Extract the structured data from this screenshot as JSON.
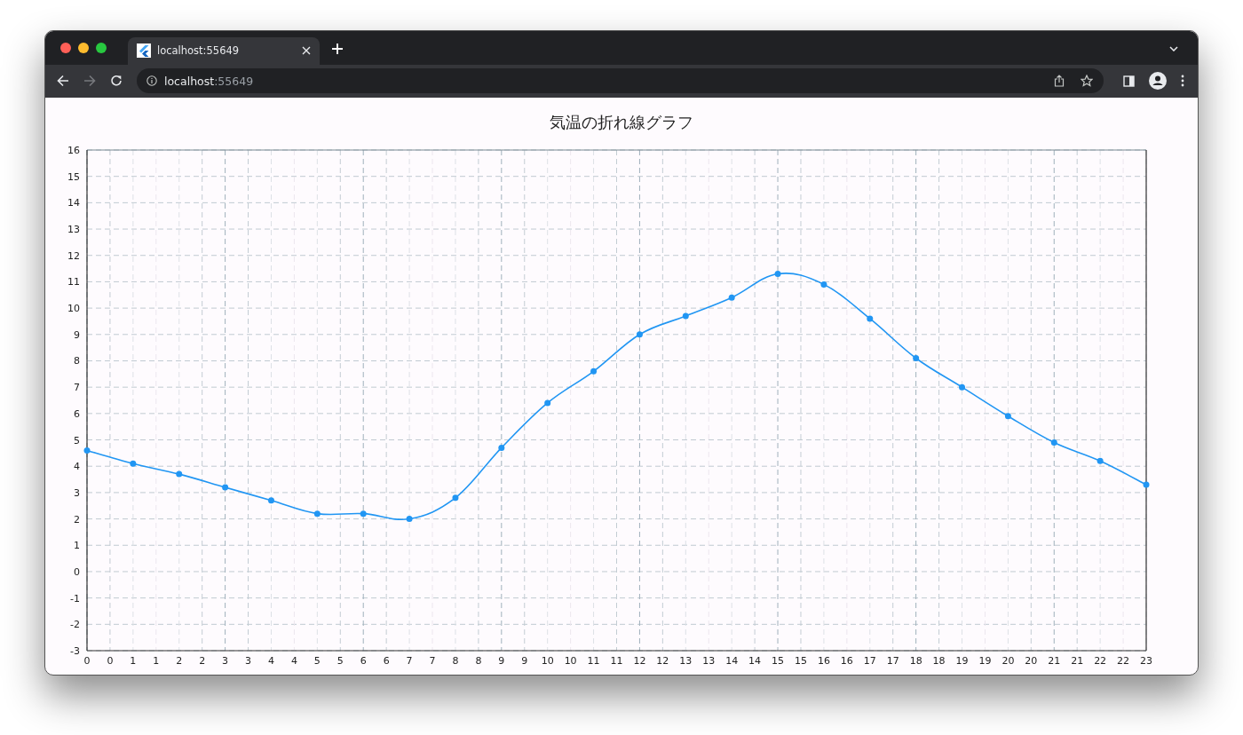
{
  "window": {
    "tab": {
      "title": "localhost:55649",
      "selected": true
    },
    "address": {
      "host": "localhost",
      "port": ":55649"
    },
    "nav": {
      "back_disabled": false,
      "forward_disabled": true
    }
  },
  "page": {
    "title": "気温の折れ線グラフ",
    "chart_data": {
      "type": "line",
      "x": [
        0,
        1,
        2,
        3,
        4,
        5,
        6,
        7,
        8,
        9,
        10,
        11,
        12,
        13,
        14,
        15,
        16,
        17,
        18,
        19,
        20,
        21,
        22,
        23
      ],
      "grid": true,
      "series": [
        {
          "color": "#2196f3",
          "marker": true,
          "values": [
            4.6,
            4.1,
            3.7,
            3.2,
            2.7,
            2.2,
            2.2,
            2.0,
            2.8,
            4.7,
            6.4,
            7.6,
            9.0,
            9.7,
            10.4,
            11.3,
            10.9,
            9.6,
            8.1,
            7.0,
            5.9,
            4.9,
            4.2,
            3.3
          ]
        }
      ],
      "xlim": [
        0,
        23
      ],
      "ylim": [
        -3,
        16
      ],
      "xticks": [
        {
          "value": 0,
          "label": "0"
        },
        {
          "value": 0.5,
          "label": "0"
        },
        {
          "value": 1,
          "label": "1"
        },
        {
          "value": 1.5,
          "label": "1"
        },
        {
          "value": 2,
          "label": "2"
        },
        {
          "value": 2.5,
          "label": "2"
        },
        {
          "value": 3,
          "label": "3"
        },
        {
          "value": 3.5,
          "label": "3"
        },
        {
          "value": 4,
          "label": "4"
        },
        {
          "value": 4.5,
          "label": "4"
        },
        {
          "value": 5,
          "label": "5"
        },
        {
          "value": 5.5,
          "label": "5"
        },
        {
          "value": 6,
          "label": "6"
        },
        {
          "value": 6.5,
          "label": "6"
        },
        {
          "value": 7,
          "label": "7"
        },
        {
          "value": 7.5,
          "label": "7"
        },
        {
          "value": 8,
          "label": "8"
        },
        {
          "value": 8.5,
          "label": "8"
        },
        {
          "value": 9,
          "label": "9"
        },
        {
          "value": 9.5,
          "label": "9"
        },
        {
          "value": 10,
          "label": "10"
        },
        {
          "value": 10.5,
          "label": "10"
        },
        {
          "value": 11,
          "label": "11"
        },
        {
          "value": 11.5,
          "label": "11"
        },
        {
          "value": 12,
          "label": "12"
        },
        {
          "value": 12.5,
          "label": "12"
        },
        {
          "value": 13,
          "label": "13"
        },
        {
          "value": 13.5,
          "label": "13"
        },
        {
          "value": 14,
          "label": "14"
        },
        {
          "value": 14.5,
          "label": "14"
        },
        {
          "value": 15,
          "label": "15"
        },
        {
          "value": 15.5,
          "label": "15"
        },
        {
          "value": 16,
          "label": "16"
        },
        {
          "value": 16.5,
          "label": "16"
        },
        {
          "value": 17,
          "label": "17"
        },
        {
          "value": 17.5,
          "label": "17"
        },
        {
          "value": 18,
          "label": "18"
        },
        {
          "value": 18.5,
          "label": "18"
        },
        {
          "value": 19,
          "label": "19"
        },
        {
          "value": 19.5,
          "label": "19"
        },
        {
          "value": 20,
          "label": "20"
        },
        {
          "value": 20.5,
          "label": "20"
        },
        {
          "value": 21,
          "label": "21"
        },
        {
          "value": 21.5,
          "label": "21"
        },
        {
          "value": 22,
          "label": "22"
        },
        {
          "value": 22.5,
          "label": "22"
        },
        {
          "value": 23,
          "label": "23"
        }
      ],
      "yticks": [
        -3,
        -2,
        -1,
        0,
        1,
        2,
        3,
        4,
        5,
        6,
        7,
        8,
        9,
        10,
        11,
        12,
        13,
        14,
        15,
        16
      ]
    }
  }
}
